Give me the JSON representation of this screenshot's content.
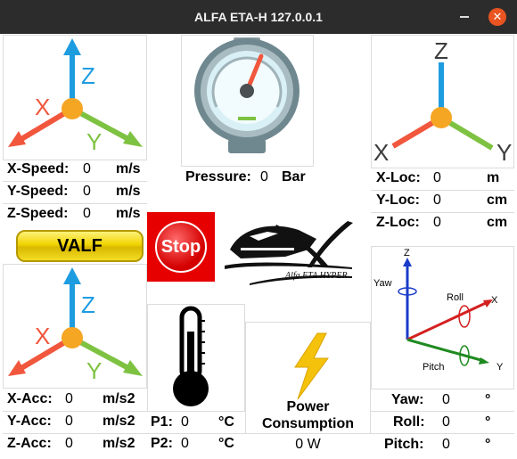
{
  "window": {
    "title": "ALFA ETA-H 127.0.0.1"
  },
  "speed": [
    {
      "label": "X-Speed:",
      "value": "0",
      "unit": "m/s"
    },
    {
      "label": "Y-Speed:",
      "value": "0",
      "unit": "m/s"
    },
    {
      "label": "Z-Speed:",
      "value": "0",
      "unit": "m/s"
    }
  ],
  "acc": [
    {
      "label": "X-Acc:",
      "value": "0",
      "unit": "m/s2"
    },
    {
      "label": "Y-Acc:",
      "value": "0",
      "unit": "m/s2"
    },
    {
      "label": "Z-Acc:",
      "value": "0",
      "unit": "m/s2"
    }
  ],
  "loc": [
    {
      "label": "X-Loc:",
      "value": "0",
      "unit": "m"
    },
    {
      "label": "Y-Loc:",
      "value": "0",
      "unit": "cm"
    },
    {
      "label": "Z-Loc:",
      "value": "0",
      "unit": "cm"
    }
  ],
  "pressure": {
    "label": "Pressure:",
    "value": "0",
    "unit": "Bar"
  },
  "temperature": [
    {
      "label": "P1:",
      "value": "0",
      "unit": "°C"
    },
    {
      "label": "P2:",
      "value": "0",
      "unit": "°C"
    }
  ],
  "power": {
    "label_line1": "Power",
    "label_line2": "Consumption",
    "value": "0 W"
  },
  "orientation": [
    {
      "label": "Yaw:",
      "value": "0",
      "unit": "°"
    },
    {
      "label": "Roll:",
      "value": "0",
      "unit": "°"
    },
    {
      "label": "Pitch:",
      "value": "0",
      "unit": "°"
    }
  ],
  "buttons": {
    "valf": "VALF",
    "stop": "Stop"
  },
  "axes_icon": {
    "x": "X",
    "y": "Y",
    "z": "Z"
  },
  "rotation_diagram": {
    "z": "Z",
    "x": "X",
    "y": "Y",
    "yaw": "Yaw",
    "roll": "Roll",
    "pitch": "Pitch"
  },
  "logo": {
    "text": "Alfa ETA HYPER"
  },
  "colors": {
    "x_axis": "#f1573d",
    "y_axis": "#7ec242",
    "z_axis": "#1e9ce0",
    "origin": "#f5a623",
    "stop": "#e60000",
    "valf": "#f0d400",
    "close": "#e95420"
  }
}
